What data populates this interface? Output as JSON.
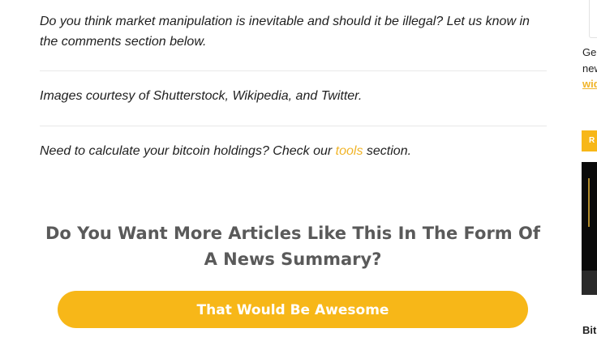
{
  "article": {
    "comment_prompt": "Do you think market manipulation is inevitable and should it be illegal? Let us know in the comments section below.",
    "image_credits": "Images courtesy of Shutterstock, Wikipedia, and Twitter.",
    "tools_prompt_before": "Need to calculate your bitcoin holdings? Check our ",
    "tools_link": "tools",
    "tools_prompt_after": " section."
  },
  "cta": {
    "heading": "Do You Want More Articles Like This In The Form Of A News Summary?",
    "button_label": "That Would Be Awesome"
  },
  "sidebar": {
    "text_line_1": "Ge",
    "text_line_2": "new",
    "link_text": "wid",
    "badge_text": "R",
    "bottom_text": "Bit"
  },
  "colors": {
    "accent": "#f7b718",
    "link": "#f0b429",
    "heading": "#5a5a5a"
  }
}
